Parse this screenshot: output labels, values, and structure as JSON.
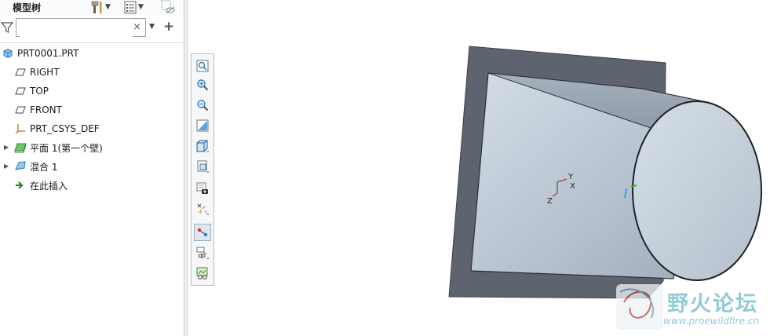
{
  "panel": {
    "title": "模型树",
    "search": {
      "placeholder": "",
      "value": ""
    },
    "clear_glyph": "×",
    "add_glyph": "+"
  },
  "tree": [
    {
      "label": "PRT0001.PRT",
      "icon": "part-icon",
      "expandable": false
    },
    {
      "label": "RIGHT",
      "icon": "datum-plane-icon",
      "expandable": false
    },
    {
      "label": "TOP",
      "icon": "datum-plane-icon",
      "expandable": false
    },
    {
      "label": "FRONT",
      "icon": "datum-plane-icon",
      "expandable": false
    },
    {
      "label": "PRT_CSYS_DEF",
      "icon": "csys-icon",
      "expandable": false
    },
    {
      "label": "平面 1(第一个壁)",
      "icon": "sheetmetal-wall-icon",
      "expandable": true
    },
    {
      "label": "混合 1",
      "icon": "blend-icon",
      "expandable": true
    },
    {
      "label": "在此插入",
      "icon": "insert-here-arrow-icon",
      "expandable": false
    }
  ],
  "toolbar_icons": [
    "refit-icon",
    "zoom-in-icon",
    "zoom-out-icon",
    "repaint-icon",
    "display-style-icon",
    "saved-orientations-icon",
    "view-manager-icon",
    "datum-display-icon",
    "annotation-display-icon",
    "spin-center-icon",
    "appearance-icon",
    "model-display-icon"
  ],
  "viewport": {
    "csys_labels": {
      "x": "X",
      "y": "Y",
      "z": "Z"
    }
  },
  "watermark": {
    "text": "野火论坛",
    "url": "www.proewildfire.cn"
  },
  "colors": {
    "accent": "#2f7fc1",
    "plate": "#5e6370",
    "body_light": "#c6d0dc",
    "body_mid": "#a6b3c3",
    "watermark": "#7ec4cf"
  }
}
